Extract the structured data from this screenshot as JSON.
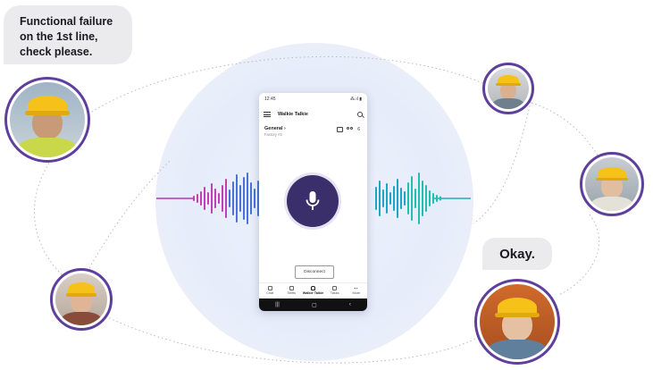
{
  "bubbles": {
    "left": {
      "lines": [
        "Functional failure",
        "on the 1st line,",
        "check please."
      ]
    },
    "right": {
      "text": "Okay."
    }
  },
  "phone": {
    "status": {
      "time": "12:45",
      "signal_text": "⁂.ıl ▮"
    },
    "app_title": "Walkie Talkie",
    "channel": {
      "name": "General",
      "chevron": "›",
      "subtitle": "Factory #2",
      "member_count": "6"
    },
    "disconnect_label": "Disconnect",
    "tabs": [
      {
        "label": "Chat",
        "icon": "chat-tab-icon"
      },
      {
        "label": "Shifts",
        "icon": "shifts-tab-icon"
      },
      {
        "label": "Walkie Talkie",
        "icon": "walkie-talkie-tab-icon",
        "active": true
      },
      {
        "label": "Tasks",
        "icon": "tasks-tab-icon"
      },
      {
        "label": "More",
        "icon": "more-tab-icon"
      }
    ],
    "navbar": {
      "recents": "|||",
      "home": "▢",
      "back": "‹"
    }
  },
  "colors": {
    "accent_purple": "#5e3f9c",
    "mic_button": "#3b2f6b",
    "wave_teal": "#1bb3b0",
    "wave_purple": "#7a4bd0",
    "helmet": "#f6c21a"
  }
}
